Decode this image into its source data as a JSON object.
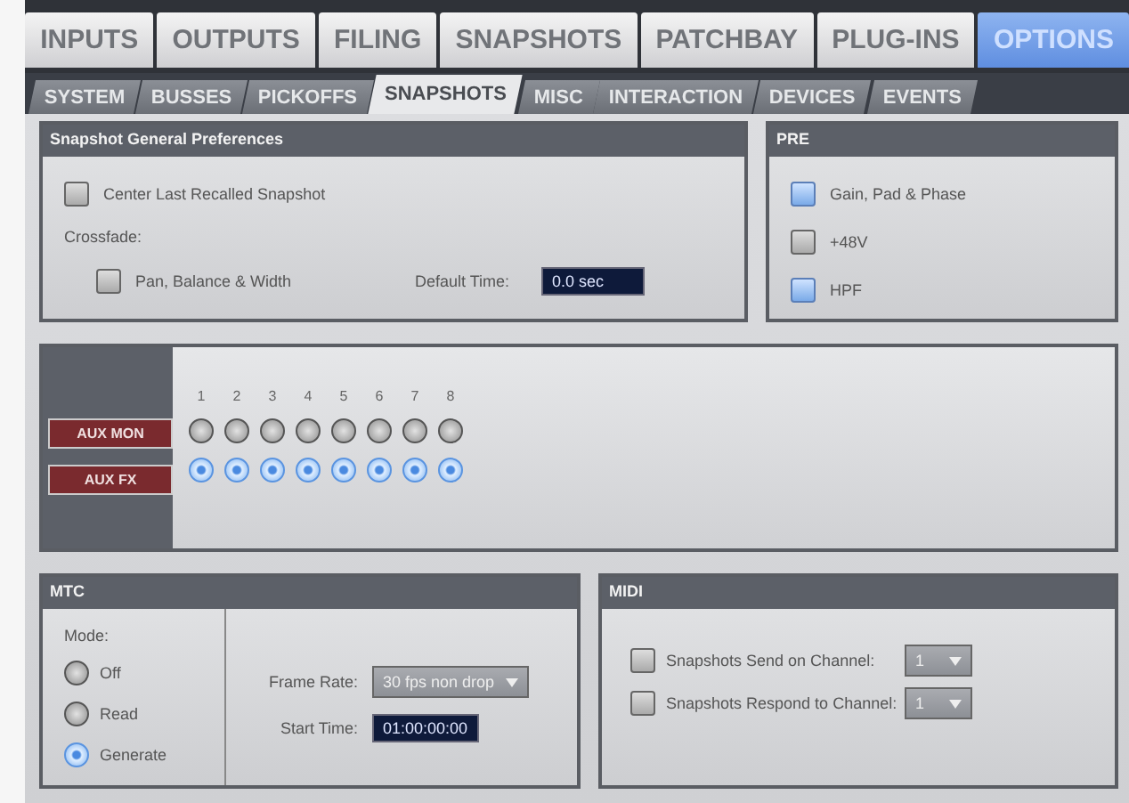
{
  "top_tabs": [
    {
      "label": "INPUTS",
      "selected": false
    },
    {
      "label": "OUTPUTS",
      "selected": false
    },
    {
      "label": "FILING",
      "selected": false
    },
    {
      "label": "SNAPSHOTS",
      "selected": false
    },
    {
      "label": "PATCHBAY",
      "selected": false
    },
    {
      "label": "PLUG-INS",
      "selected": false
    },
    {
      "label": "OPTIONS",
      "selected": true
    }
  ],
  "sub_tabs": [
    {
      "label": "SYSTEM",
      "selected": false
    },
    {
      "label": "BUSSES",
      "selected": false
    },
    {
      "label": "PICKOFFS",
      "selected": false
    },
    {
      "label": "SNAPSHOTS",
      "selected": true
    },
    {
      "label": "MISC",
      "selected": false
    },
    {
      "label": "INTERACTION",
      "selected": false
    },
    {
      "label": "DEVICES",
      "selected": false
    },
    {
      "label": "EVENTS",
      "selected": false
    }
  ],
  "general": {
    "title": "Snapshot General Preferences",
    "center_last": {
      "label": "Center Last Recalled Snapshot",
      "checked": false
    },
    "crossfade_label": "Crossfade:",
    "pan_balance": {
      "label": "Pan, Balance & Width",
      "checked": false
    },
    "default_time_label": "Default Time:",
    "default_time": "0.0 sec"
  },
  "pre": {
    "title": "PRE",
    "items": [
      {
        "label": "Gain, Pad & Phase",
        "checked": true
      },
      {
        "label": "+48V",
        "checked": false
      },
      {
        "label": "HPF",
        "checked": true
      }
    ]
  },
  "aux": {
    "numbers": [
      "1",
      "2",
      "3",
      "4",
      "5",
      "6",
      "7",
      "8"
    ],
    "rows": [
      {
        "label": "AUX MON",
        "buttons": [
          false,
          false,
          false,
          false,
          false,
          false,
          false,
          false
        ]
      },
      {
        "label": "AUX FX",
        "buttons": [
          true,
          true,
          true,
          true,
          true,
          true,
          true,
          true
        ]
      }
    ]
  },
  "mtc": {
    "title": "MTC",
    "mode_label": "Mode:",
    "modes": [
      {
        "label": "Off",
        "selected": false
      },
      {
        "label": "Read",
        "selected": false
      },
      {
        "label": "Generate",
        "selected": true
      }
    ],
    "frame_rate_label": "Frame Rate:",
    "frame_rate": "30 fps non drop",
    "start_time_label": "Start Time:",
    "start_time": "01:00:00:00"
  },
  "midi": {
    "title": "MIDI",
    "items": [
      {
        "label": "Snapshots Send on Channel:",
        "checked": false,
        "channel": "1"
      },
      {
        "label": "Snapshots Respond to Channel:",
        "checked": false,
        "channel": "1"
      }
    ]
  }
}
